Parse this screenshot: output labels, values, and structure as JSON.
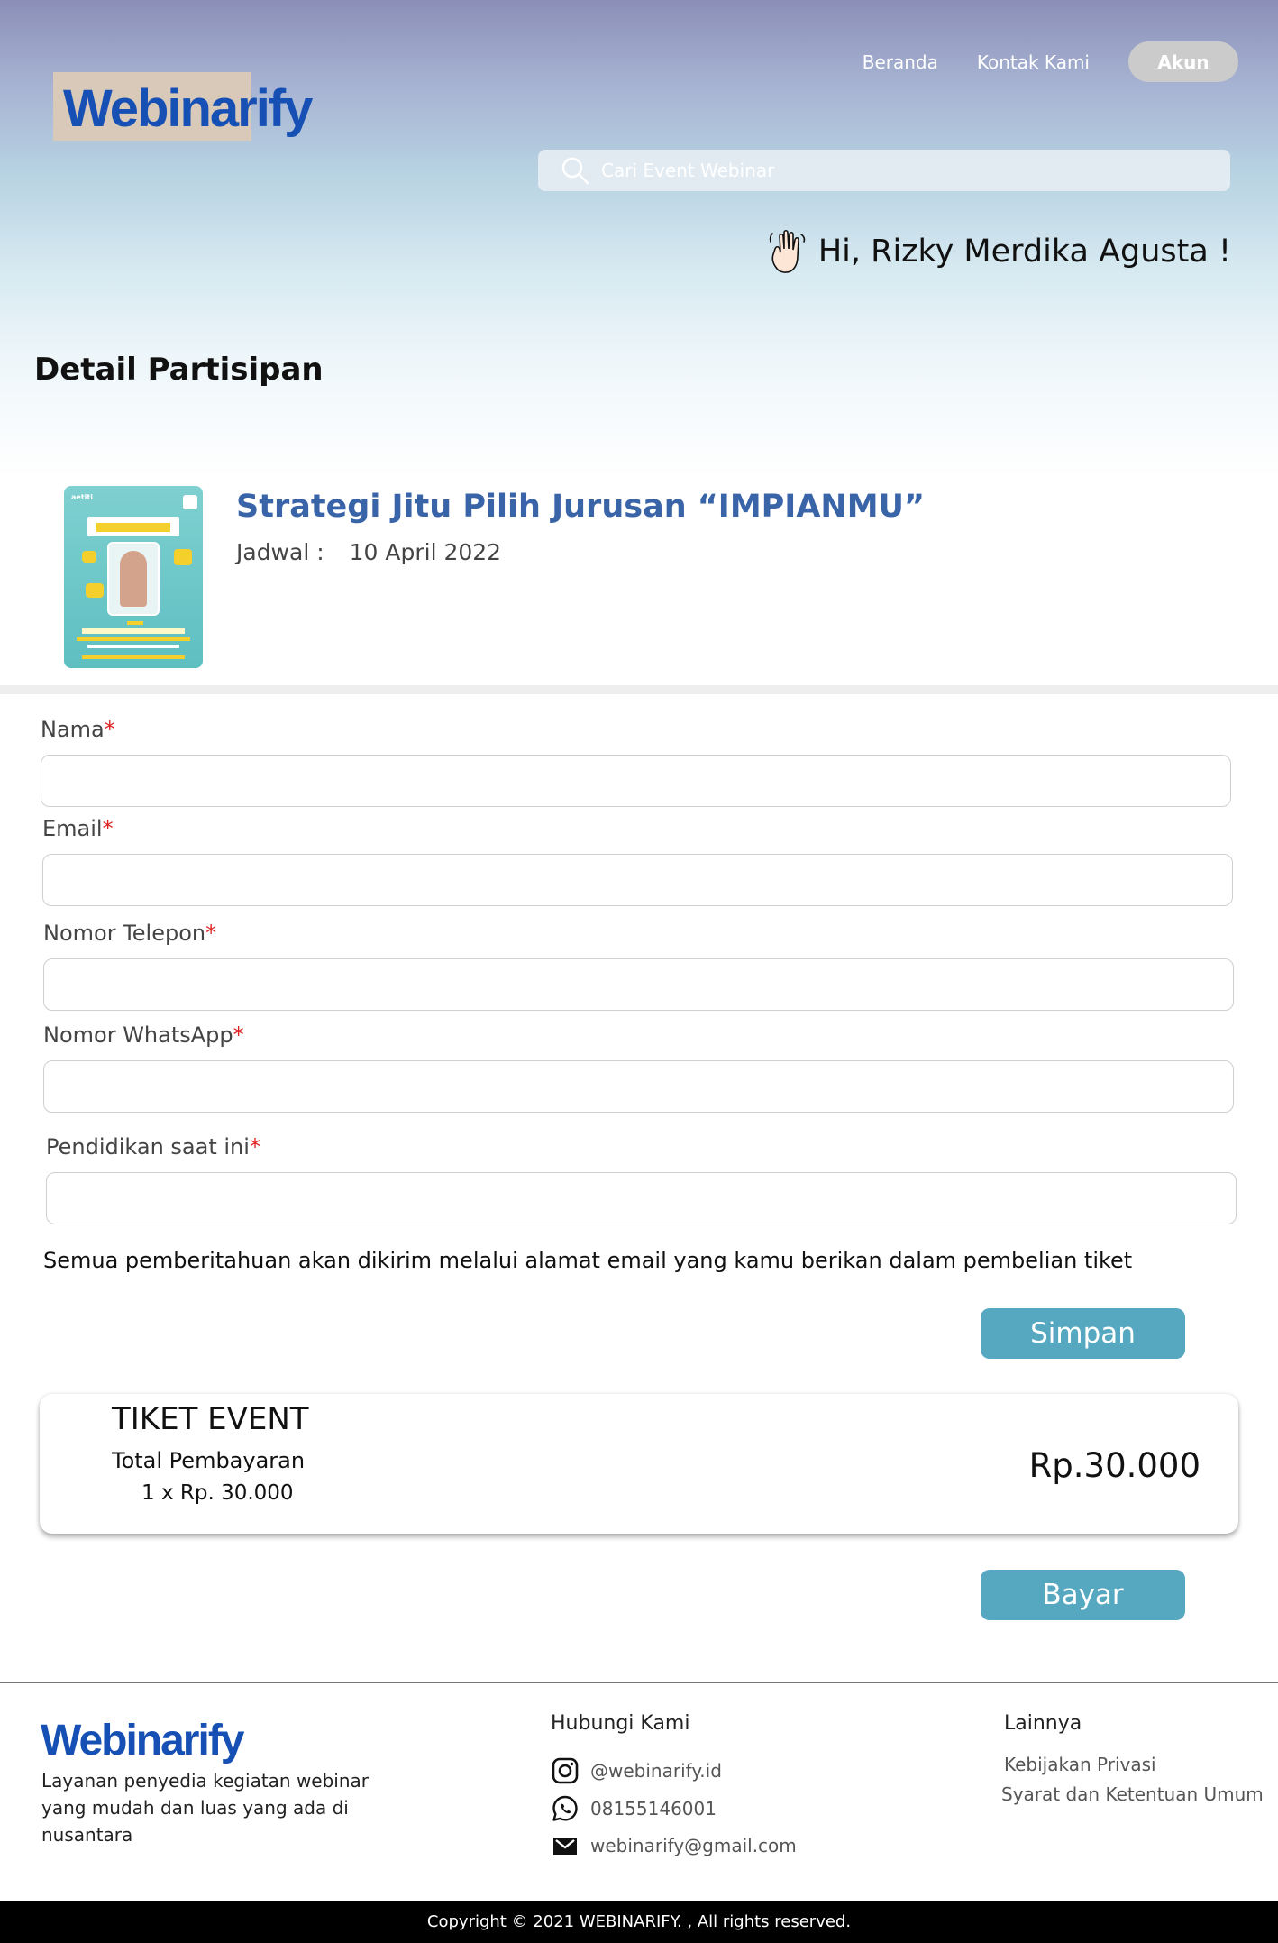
{
  "header": {
    "logo": "Webinarify",
    "nav": {
      "home": "Beranda",
      "contact": "Kontak Kami",
      "account": "Akun"
    },
    "search": {
      "placeholder": "Cari Event Webinar",
      "value": ""
    },
    "greeting": "Hi, Rizky Merdika Agusta !"
  },
  "page": {
    "title": "Detail Partisipan"
  },
  "event": {
    "title": "Strategi Jitu Pilih Jurusan “IMPIANMU”",
    "schedule_label": "Jadwal :",
    "schedule_date": "10 April 2022",
    "thumbnail": {
      "brand": "aetiti",
      "headline": "STRATEGI JITU PILIH JURUSAN",
      "highlight": "“IMPIANMU”",
      "speaker": "“Yustisia A. S., M.Psi., Psikolog”"
    }
  },
  "form": {
    "required_mark": "*",
    "fields": [
      {
        "label": "Nama",
        "value": ""
      },
      {
        "label": "Email",
        "value": ""
      },
      {
        "label": "Nomor Telepon",
        "value": ""
      },
      {
        "label": "Nomor WhatsApp",
        "value": ""
      },
      {
        "label": "Pendidikan saat ini",
        "value": ""
      }
    ],
    "notice": "Semua pemberitahuan akan dikirim melalui alamat email yang kamu berikan dalam pembelian tiket",
    "save_label": "Simpan"
  },
  "ticket": {
    "title": "TIKET EVENT",
    "total_label": "Total Pembayaran",
    "quantity_line": "1 x Rp. 30.000",
    "amount": "Rp.30.000",
    "pay_label": "Bayar"
  },
  "footer": {
    "logo": "Webinarify",
    "description": "Layanan penyedia kegiatan webinar yang mudah dan luas yang ada di nusantara",
    "contact_heading": "Hubungi Kami",
    "instagram": "@webinarify.id",
    "whatsapp": "08155146001",
    "email": "webinarify@gmail.com",
    "others_heading": "Lainnya",
    "privacy": "Kebijakan Privasi",
    "terms": "Syarat dan Ketentuan Umum",
    "copyright": "Copyright © 2021 WEBINARIFY. , All rights reserved."
  },
  "colors": {
    "brand_blue": "#1650b4",
    "event_title": "#3a64a8",
    "button": "#56a8c0",
    "required": "#e02020"
  }
}
